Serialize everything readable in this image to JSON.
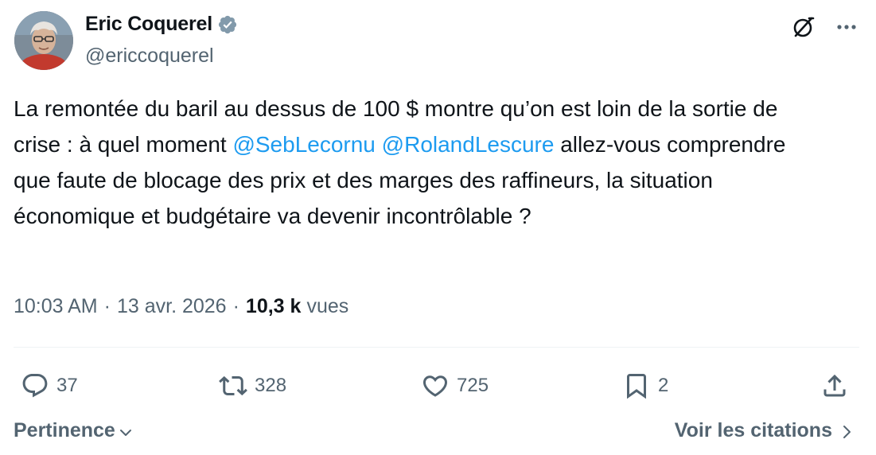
{
  "author": {
    "display_name": "Eric Coquerel",
    "handle": "@ericcoquerel",
    "verified": true
  },
  "tweet": {
    "text_segments": [
      {
        "type": "text",
        "value": "La remontée du baril au dessus de 100 $ montre qu’on est loin de la sortie de crise : à quel moment "
      },
      {
        "type": "mention",
        "value": "@SebLecornu"
      },
      {
        "type": "text",
        "value": " "
      },
      {
        "type": "mention",
        "value": "@RolandLescure"
      },
      {
        "type": "text",
        "value": " allez-vous comprendre que faute de blocage des prix et des marges des raffineurs, la situation économique et budgétaire va devenir incontrôlable ?"
      }
    ]
  },
  "meta": {
    "time": "10:03 AM",
    "separator": "·",
    "date": "13 avr. 2026",
    "views_count": "10,3 k",
    "views_label": "vues"
  },
  "actions": {
    "replies": "37",
    "retweets": "328",
    "likes": "725",
    "bookmarks": "2"
  },
  "footer": {
    "sort_label": "Pertinence",
    "quotes_label": "Voir les citations"
  },
  "colors": {
    "accent": "#1d9bf0",
    "text": "#0f1419",
    "secondary": "#536471",
    "divider": "#eff3f4"
  },
  "icons": {
    "reply": "speech-bubble-icon",
    "retweet": "retweet-arrows-icon",
    "like": "heart-icon",
    "bookmark": "bookmark-icon",
    "share": "share-upload-icon",
    "grok": "grok-slash-circle-icon",
    "more": "more-dots-icon",
    "verified": "verified-badge-icon",
    "sort": "chevron-down-icon",
    "quotes": "chevron-right-icon"
  }
}
